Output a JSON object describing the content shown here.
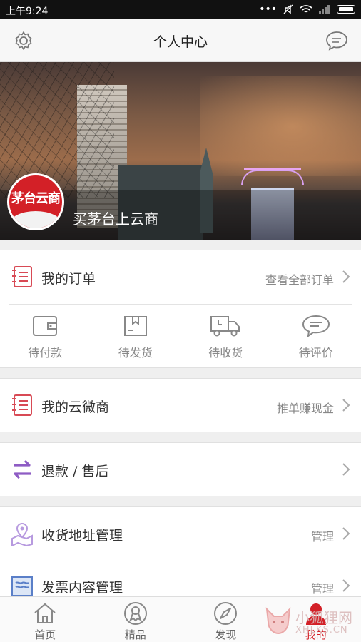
{
  "status_bar": {
    "time": "上午9:24",
    "icons": [
      "dots-icon",
      "mute-icon",
      "wifi-icon",
      "signal-icon",
      "battery-icon"
    ]
  },
  "header": {
    "title": "个人中心"
  },
  "profile": {
    "avatar_text": "茅台云商",
    "username": "买茅台上云商"
  },
  "orders": {
    "title": "我的订单",
    "link": "查看全部订单",
    "statuses": [
      {
        "label": "待付款",
        "icon": "wallet-icon"
      },
      {
        "label": "待发货",
        "icon": "box-icon"
      },
      {
        "label": "待收货",
        "icon": "truck-icon"
      },
      {
        "label": "待评价",
        "icon": "comment-icon"
      }
    ]
  },
  "micro_shop": {
    "title": "我的云微商",
    "link": "推单赚现金"
  },
  "refund": {
    "title": "退款 / 售后"
  },
  "address": {
    "title": "收货地址管理",
    "link": "管理"
  },
  "invoice": {
    "title": "发票内容管理",
    "link": "管理"
  },
  "tabs": [
    {
      "label": "首页",
      "icon": "home-icon"
    },
    {
      "label": "精品",
      "icon": "award-icon"
    },
    {
      "label": "发现",
      "icon": "compass-icon"
    },
    {
      "label": "我的",
      "icon": "user-icon",
      "active": true
    }
  ],
  "watermark": {
    "text_cn": "小狐狸网",
    "text_en": "XHLKS.CN"
  },
  "colors": {
    "accent": "#d32027",
    "purple": "#8e5cc4",
    "blue": "#5a7fc8",
    "muted": "#888888"
  }
}
